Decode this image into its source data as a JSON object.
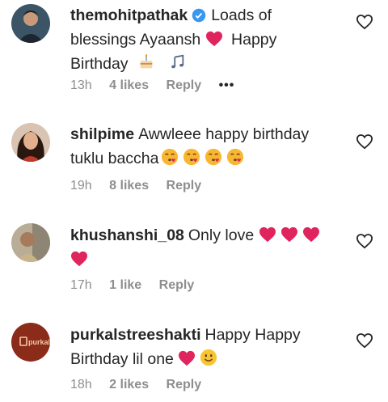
{
  "comments": [
    {
      "username": "themohitpathak",
      "verified": true,
      "text_parts": [
        "Loads of blessings Ayaansh",
        "Happy Birthday"
      ],
      "time": "13h",
      "likes": "4 likes",
      "reply": "Reply",
      "more": "•••"
    },
    {
      "username": "shilpime",
      "text_parts": [
        "Awwleee happy birthday tuklu baccha"
      ],
      "time": "19h",
      "likes": "8 likes",
      "reply": "Reply"
    },
    {
      "username": "khushanshi_08",
      "text_parts": [
        "Only love"
      ],
      "time": "17h",
      "likes": "1 like",
      "reply": "Reply"
    },
    {
      "username": "purkalstreeshakti",
      "text_parts": [
        "Happy Happy Birthday lil one"
      ],
      "time": "18h",
      "likes": "2 likes",
      "reply": "Reply",
      "avatar_logo_text": "purkal"
    }
  ],
  "colors": {
    "heart": "#e0245e",
    "meta": "#8e8e8e",
    "text": "#262626",
    "verified": "#3897f0"
  },
  "icons": [
    "heart-outline-icon",
    "verified-badge-icon",
    "red-heart-emoji",
    "birthday-cake-emoji",
    "music-notes-emoji",
    "kissing-face-emoji",
    "smiling-face-emoji"
  ]
}
